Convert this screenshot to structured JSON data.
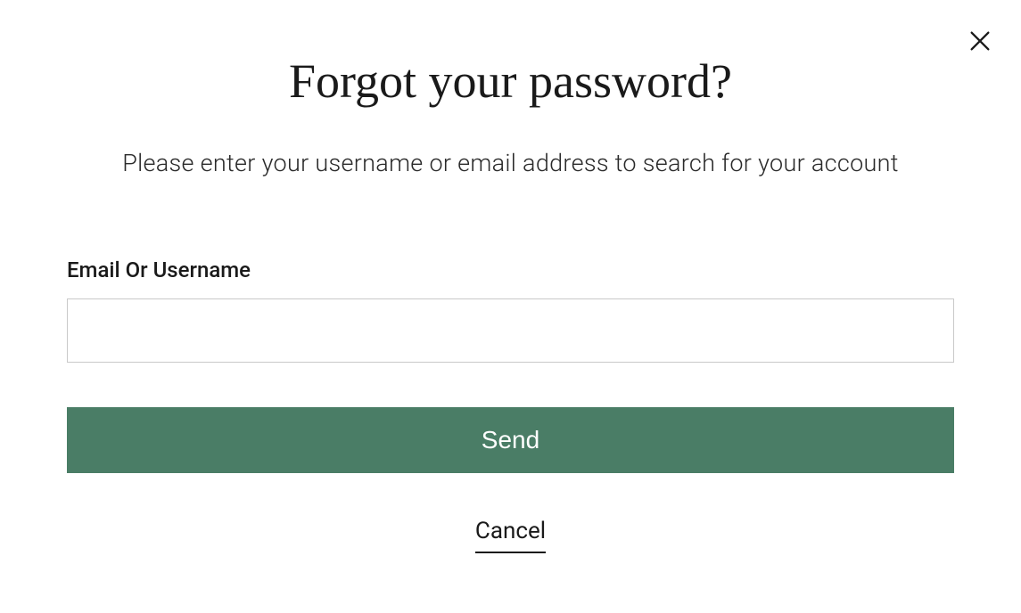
{
  "modal": {
    "title": "Forgot your password?",
    "subtitle": "Please enter your username or email address to search for your account",
    "field_label": "Email Or Username",
    "input_value": "",
    "send_label": "Send",
    "cancel_label": "Cancel"
  }
}
